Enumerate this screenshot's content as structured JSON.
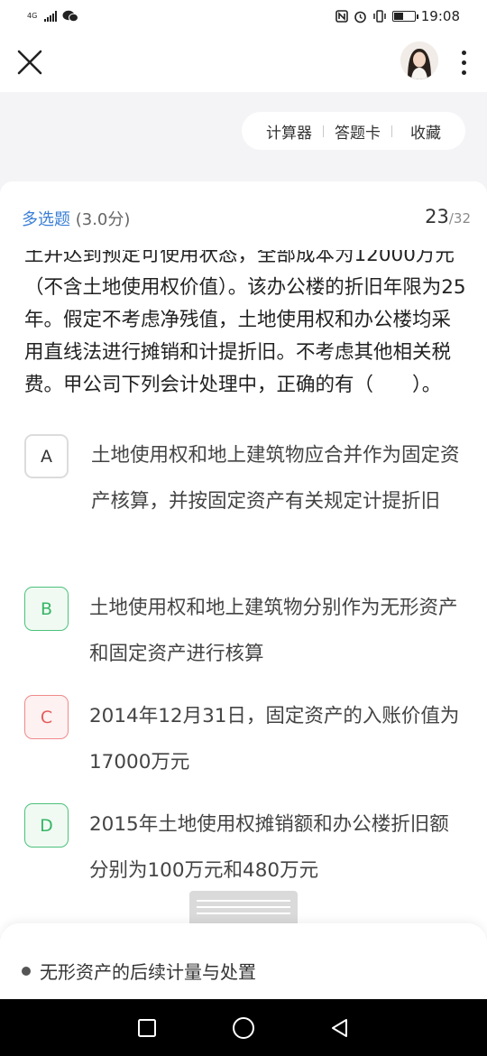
{
  "status_bar": {
    "network": "4G",
    "time": "19:08",
    "battery_level": 0.45
  },
  "toolbar": {
    "calculator": "计算器",
    "answer_card": "答题卡",
    "favorite": "收藏"
  },
  "question": {
    "type": "多选题",
    "score": "(3.0分)",
    "current": "23",
    "total": "/32",
    "stem": "土并达到预定可使用状态，全部成本为12000万元（不含土地使用权价值）。该办公楼的折旧年限为25年。假定不考虑净残值，土地使用权和办公楼均采用直线法进行摊销和计提折旧。不考虑其他相关税费。甲公司下列会计处理中，正确的有（　　）。",
    "options": [
      {
        "letter": "A",
        "text": "土地使用权和地上建筑物应合并作为固定资产核算，并按固定资产有关规定计提折旧",
        "state": "unselected"
      },
      {
        "letter": "B",
        "text": "土地使用权和地上建筑物分别作为无形资产和固定资产进行核算",
        "state": "correct"
      },
      {
        "letter": "C",
        "text": "2014年12月31日，固定资产的入账价值为17000万元",
        "state": "wrong"
      },
      {
        "letter": "D",
        "text": "2015年土地使用权摊销额和办公楼折旧额分别为100万元和480万元",
        "state": "correct"
      }
    ]
  },
  "knowledge_point": "无形资产的后续计量与处置",
  "colors": {
    "accent_blue": "#3a7fd5",
    "correct_green": "#36b566",
    "wrong_red": "#e45c5c"
  }
}
